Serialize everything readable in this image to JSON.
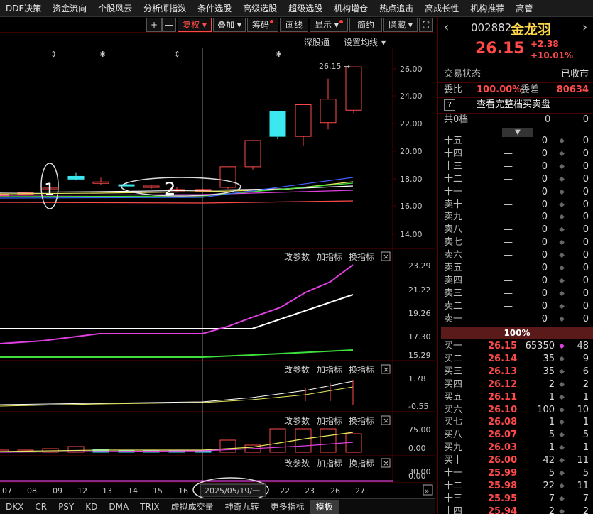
{
  "top_menu": [
    "DDE决策",
    "资金流向",
    "个股风云",
    "分析师指数",
    "条件选股",
    "高级选股",
    "超级选股",
    "机构增仓",
    "热点追击",
    "高成长性",
    "机构推荐",
    "高管"
  ],
  "toolbar": {
    "plus": "+",
    "minus": "—",
    "fuquan": "复权",
    "overlay": "叠加",
    "chip": "筹码",
    "draw": "画线",
    "display": "显示",
    "simple": "简约",
    "hide": "隐藏",
    "expand": "⛶"
  },
  "chart_header": {
    "exchange": "深股通",
    "set_ma": "设置均线"
  },
  "main_axis_labels": [
    "26.00",
    "24.00",
    "22.00",
    "20.00",
    "18.00",
    "16.00",
    "14.00"
  ],
  "max_price_label": "26.15",
  "annotations": {
    "mark1": "1",
    "mark2": "2"
  },
  "panel_labels": {
    "change_params": "改参数",
    "add_indicator": "加指标",
    "swap_indicator": "换指标",
    "close": "×"
  },
  "panel2_axis": [
    "23.29",
    "21.22",
    "19.26",
    "17.30",
    "15.29"
  ],
  "panel3_axis": [
    "1.78",
    "-0.55"
  ],
  "panel4_axis": [
    "75.00",
    "0.00"
  ],
  "panel5_axis": [
    "30.00",
    "0.00"
  ],
  "x_axis_labels": [
    "07",
    "08",
    "09",
    "12",
    "13",
    "14",
    "15",
    "16",
    "",
    "",
    "22",
    "23",
    "26",
    "27"
  ],
  "cursor_date": "2025/05/19/一",
  "bottom_tabs": [
    "DKX",
    "CR",
    "PSY",
    "KD",
    "DMA",
    "TRIX",
    "虚拟成交量",
    "神奇九转",
    "更多指标",
    "模板"
  ],
  "stock": {
    "code": "002882",
    "name": "金龙羽",
    "price": "26.15",
    "change": "+2.38",
    "change_pct": "+10.01%"
  },
  "status": {
    "label": "交易状态",
    "value": "已收市"
  },
  "ratio": {
    "wb_label": "委比",
    "wb_value": "100.00%",
    "wc_label": "委差",
    "wc_value": "80634"
  },
  "full_book": {
    "help": "?",
    "label": "查看完整档买卖盘"
  },
  "total_levels": {
    "label": "共0档",
    "a": "0",
    "b": "0"
  },
  "sell_levels": [
    {
      "label": "十五",
      "price": "—",
      "vol": "0",
      "n": "0"
    },
    {
      "label": "十四",
      "price": "—",
      "vol": "0",
      "n": "0"
    },
    {
      "label": "十三",
      "price": "—",
      "vol": "0",
      "n": "0"
    },
    {
      "label": "十二",
      "price": "—",
      "vol": "0",
      "n": "0"
    },
    {
      "label": "十一",
      "price": "—",
      "vol": "0",
      "n": "0"
    },
    {
      "label": "卖十",
      "price": "—",
      "vol": "0",
      "n": "0"
    },
    {
      "label": "卖九",
      "price": "—",
      "vol": "0",
      "n": "0"
    },
    {
      "label": "卖八",
      "price": "—",
      "vol": "0",
      "n": "0"
    },
    {
      "label": "卖七",
      "price": "—",
      "vol": "0",
      "n": "0"
    },
    {
      "label": "卖六",
      "price": "—",
      "vol": "0",
      "n": "0"
    },
    {
      "label": "卖五",
      "price": "—",
      "vol": "0",
      "n": "0"
    },
    {
      "label": "卖四",
      "price": "—",
      "vol": "0",
      "n": "0"
    },
    {
      "label": "卖三",
      "price": "—",
      "vol": "0",
      "n": "0"
    },
    {
      "label": "卖二",
      "price": "—",
      "vol": "0",
      "n": "0"
    },
    {
      "label": "卖一",
      "price": "—",
      "vol": "0",
      "n": "0"
    }
  ],
  "pct_bar": "100%",
  "buy_levels": [
    {
      "label": "买一",
      "price": "26.15",
      "vol": "65350",
      "n": "48"
    },
    {
      "label": "买二",
      "price": "26.14",
      "vol": "35",
      "n": "9"
    },
    {
      "label": "买三",
      "price": "26.13",
      "vol": "35",
      "n": "6"
    },
    {
      "label": "买四",
      "price": "26.12",
      "vol": "2",
      "n": "2"
    },
    {
      "label": "买五",
      "price": "26.11",
      "vol": "1",
      "n": "1"
    },
    {
      "label": "买六",
      "price": "26.10",
      "vol": "100",
      "n": "10"
    },
    {
      "label": "买七",
      "price": "26.08",
      "vol": "1",
      "n": "1"
    },
    {
      "label": "买八",
      "price": "26.07",
      "vol": "5",
      "n": "5"
    },
    {
      "label": "买九",
      "price": "26.03",
      "vol": "1",
      "n": "1"
    },
    {
      "label": "买十",
      "price": "26.00",
      "vol": "42",
      "n": "11"
    },
    {
      "label": "十一",
      "price": "25.99",
      "vol": "5",
      "n": "5"
    },
    {
      "label": "十二",
      "price": "25.98",
      "vol": "22",
      "n": "11"
    },
    {
      "label": "十三",
      "price": "25.95",
      "vol": "7",
      "n": "7"
    },
    {
      "label": "十四",
      "price": "25.94",
      "vol": "2",
      "n": "2"
    }
  ],
  "colors": {
    "up": "#ff4a4a",
    "down": "#3be8f0",
    "name": "#ffd84a",
    "bg": "#000000"
  }
}
